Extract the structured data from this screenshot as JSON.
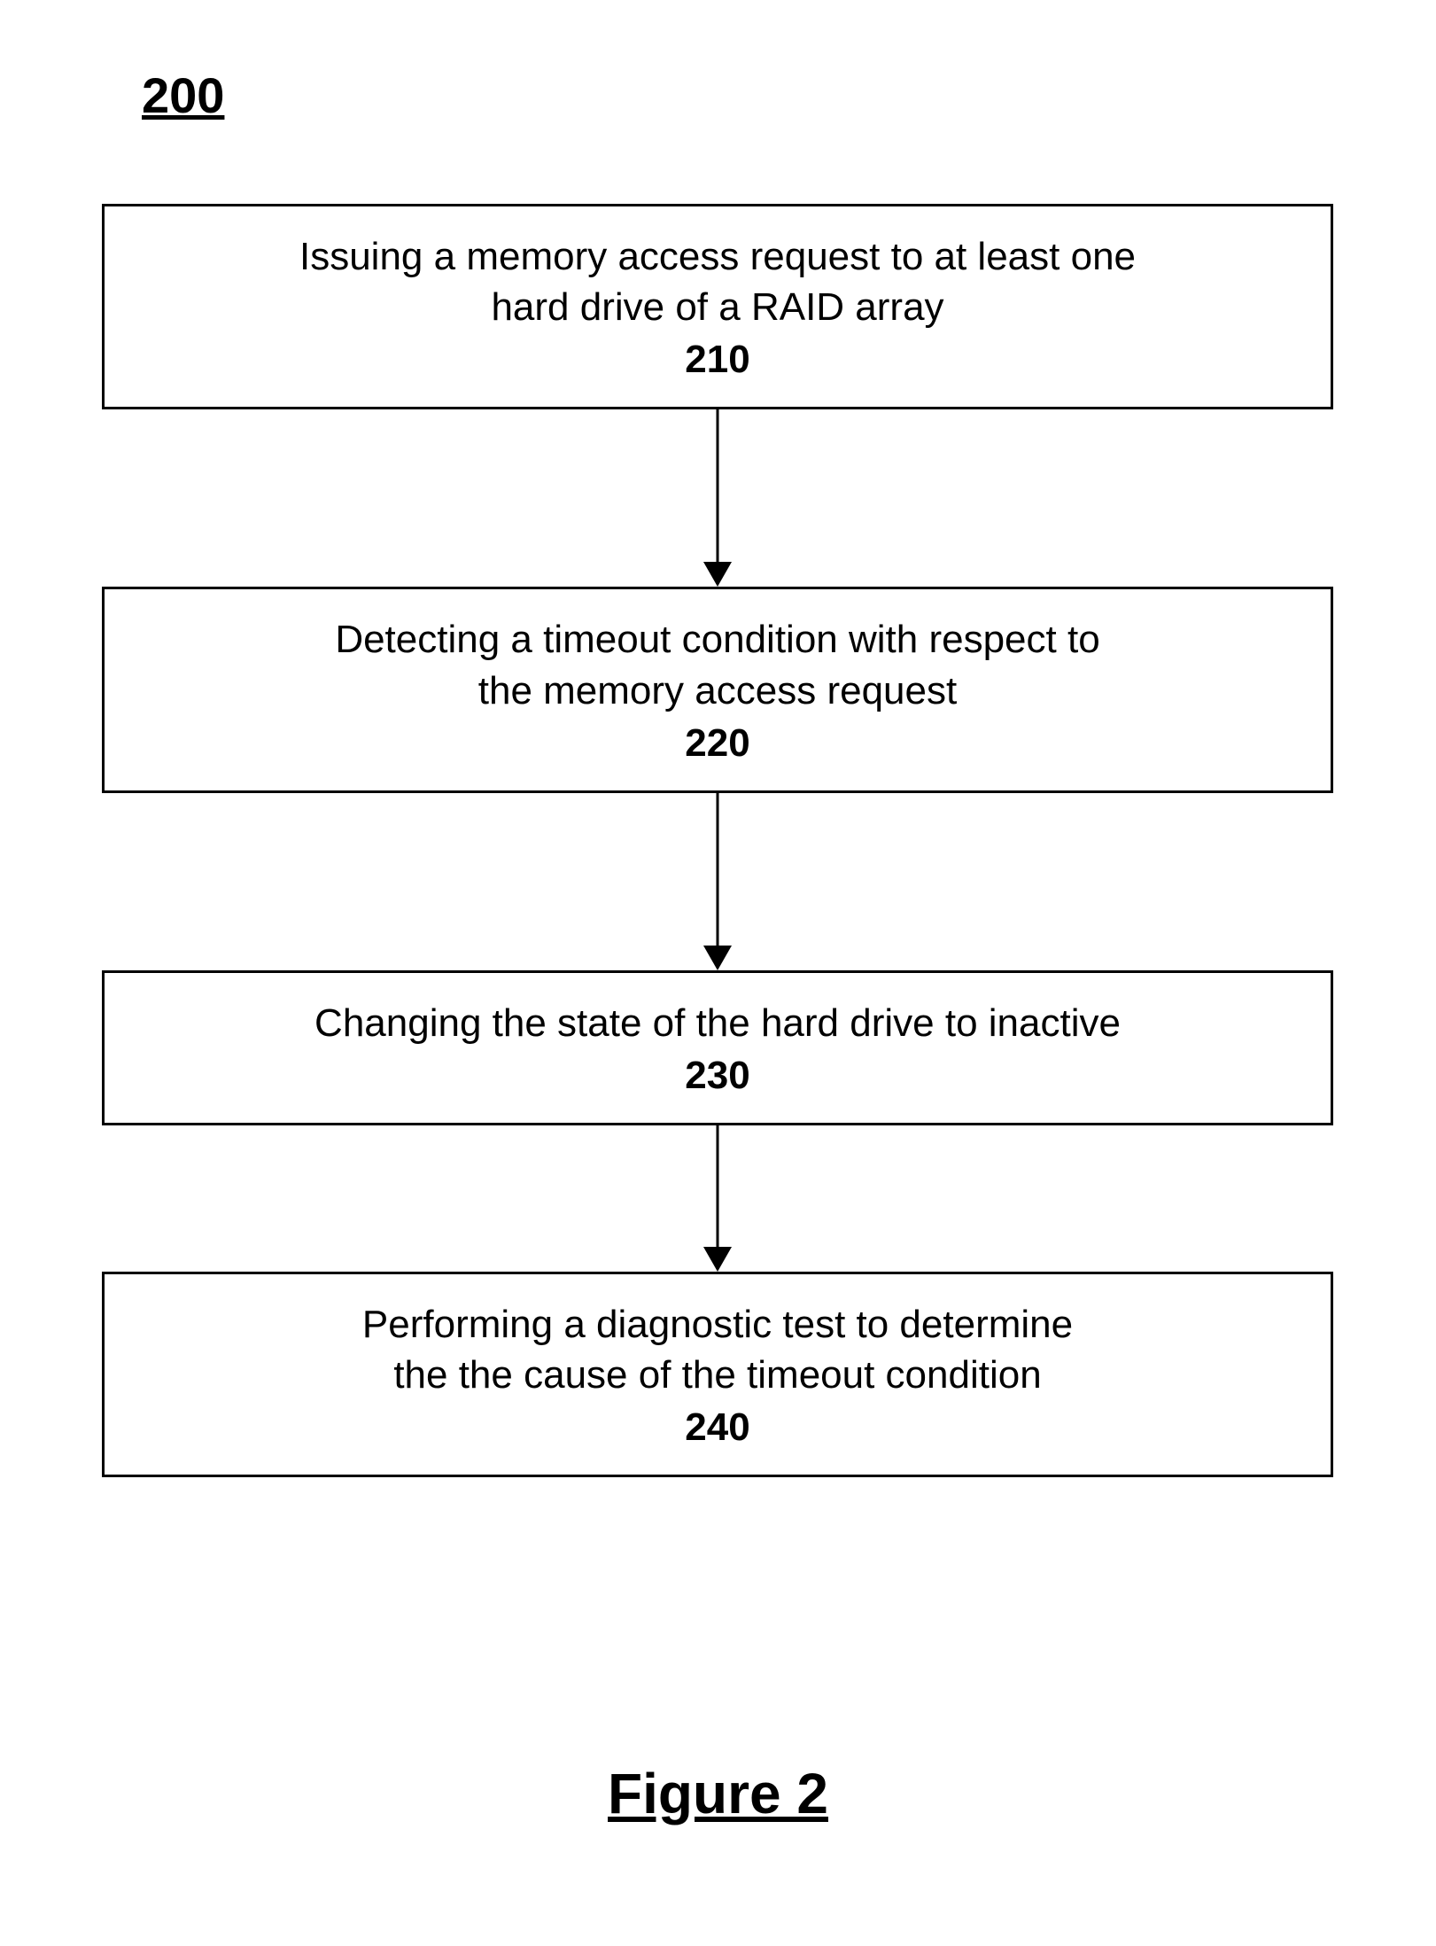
{
  "figure_number": "200",
  "caption": "Figure 2",
  "steps": [
    {
      "text_line1": "Issuing a memory access request to at least one",
      "text_line2": "hard drive of a RAID array",
      "ref": "210"
    },
    {
      "text_line1": "Detecting a timeout condition with respect to",
      "text_line2": "the memory access request",
      "ref": "220"
    },
    {
      "text_line1": "Changing the state of the hard drive to inactive",
      "text_line2": "",
      "ref": "230"
    },
    {
      "text_line1": "Performing a diagnostic test to determine",
      "text_line2": "the the cause of the timeout condition",
      "ref": "240"
    }
  ]
}
